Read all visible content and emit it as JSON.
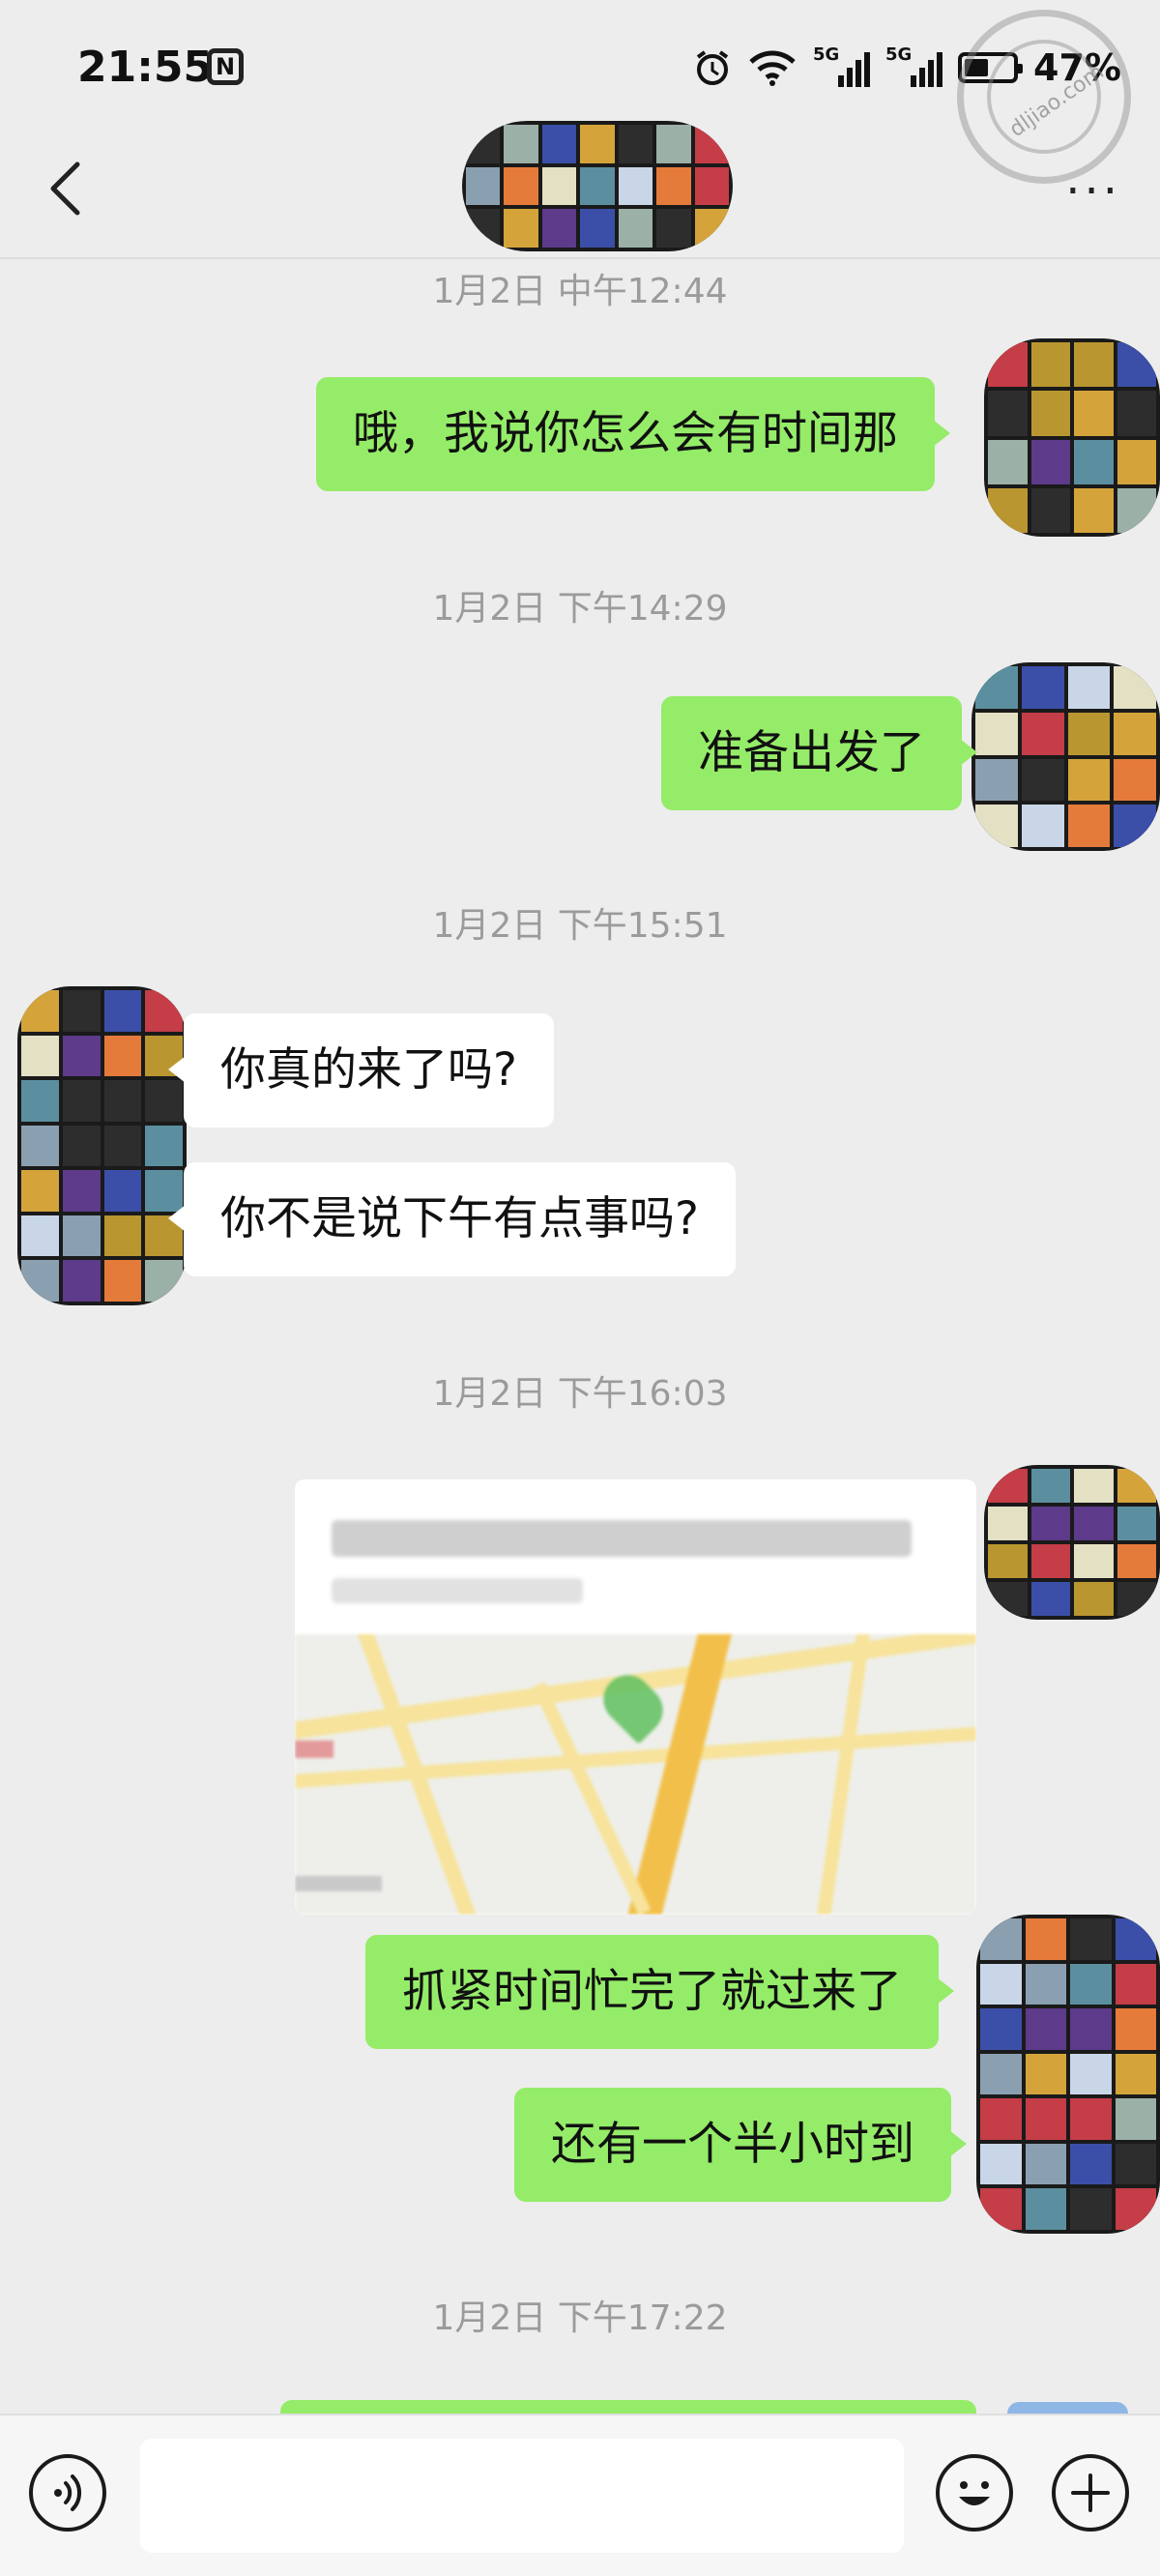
{
  "status_bar": {
    "time": "21:55",
    "nfc_label": "N",
    "network_tag_1": "5G",
    "network_tag_2": "5G",
    "battery_percent": "47%",
    "battery_level": 0.47
  },
  "nav": {
    "back_icon": "chevron-left-icon",
    "more_label": "···"
  },
  "messages": [
    {
      "type": "timestamp",
      "text": "1月2日 中午12:44"
    },
    {
      "type": "text",
      "side": "me",
      "text": "哦，我说你怎么会有时间那"
    },
    {
      "type": "timestamp",
      "text": "1月2日 下午14:29"
    },
    {
      "type": "text",
      "side": "me",
      "text": "准备出发了"
    },
    {
      "type": "timestamp",
      "text": "1月2日 下午15:51"
    },
    {
      "type": "text",
      "side": "them",
      "text": "你真的来了吗?"
    },
    {
      "type": "text",
      "side": "them",
      "text": "你不是说下午有点事吗?"
    },
    {
      "type": "timestamp",
      "text": "1月2日 下午16:03"
    },
    {
      "type": "location",
      "side": "me"
    },
    {
      "type": "text",
      "side": "me",
      "text": "抓紧时间忙完了就过来了"
    },
    {
      "type": "text",
      "side": "me",
      "text": "还有一个半小时到"
    },
    {
      "type": "timestamp",
      "text": "1月2日 下午17:22"
    }
  ],
  "input": {
    "placeholder": ""
  },
  "colors": {
    "my_bubble": "#95ec69",
    "their_bubble": "#ffffff",
    "background": "#ededed"
  },
  "icons": {
    "voice": "voice-icon",
    "emoji": "emoji-icon",
    "plus": "plus-icon"
  }
}
